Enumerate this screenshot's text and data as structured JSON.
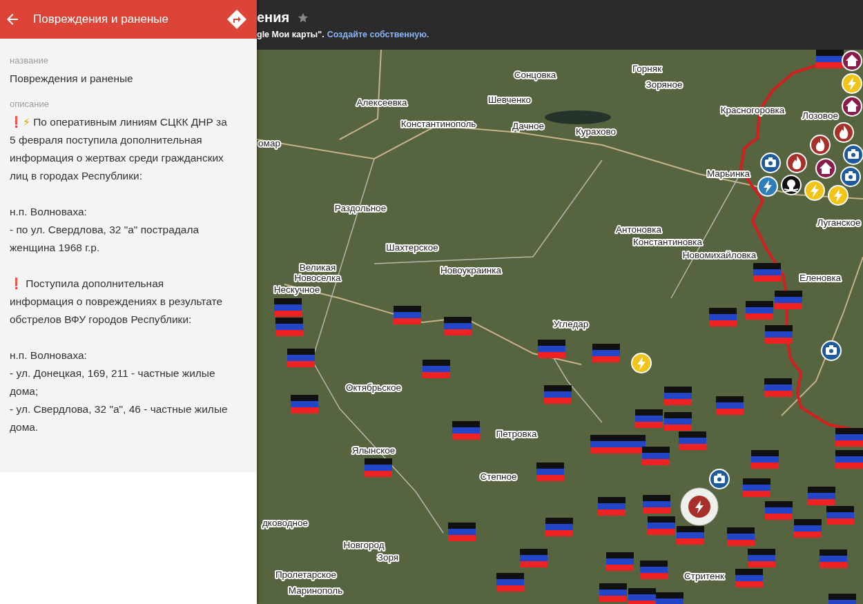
{
  "panel": {
    "title": "Повреждения и раненые",
    "fields": [
      {
        "label": "название",
        "paragraphs": [
          {
            "text": "Повреждения и раненые"
          }
        ]
      },
      {
        "label": "описание",
        "paragraphs": [
          {
            "icons": [
              {
                "kind": "exclamation",
                "char": "❗"
              },
              {
                "kind": "lightning",
                "char": "⚡"
              }
            ],
            "text": "По оперативным линиям СЦКК ДНР за 5 февраля поступила дополнительная информация о жертвах среди гражданских лиц в городах Республики:"
          },
          {
            "text": "н.п. Волноваха:\n- по ул. Свердлова, 32 \"а\" пострадала женщина 1968 г.р."
          },
          {
            "icons": [
              {
                "kind": "exclamation",
                "char": "❗"
              }
            ],
            "text": "Поступила дополнительная информация о повреждениях в результате обстрелов ВФУ городов Республики:"
          },
          {
            "text": "н.п. Волноваха:\n- ул. Донецкая, 169, 211 - частные жилые дома;\n- ул. Свердлова, 32 \"а\", 46 - частные жилые дома."
          }
        ]
      }
    ]
  },
  "map_header": {
    "title": "ения",
    "note": "gle Мои карты\".",
    "link": "Создайте собственную."
  },
  "map": {
    "labels": [
      "Сонцовка",
      "Горняк",
      "Зоряное",
      "Алексеевка",
      "Шевченко",
      "Красногоровка",
      "Лозовое",
      "Константинополь",
      "Дачное",
      "Курахово",
      "омар",
      "Марьинка",
      "Раздольное",
      "Антоновка",
      "Константиновка",
      "Луганское",
      "Шахтерское",
      "Новомихайловка",
      "Великая",
      "Новоселка",
      "Новоукраинка",
      "Нескучное",
      "Еленовка",
      "Угледар",
      "Октябрьское",
      "Петровка",
      "Ялынское",
      "Степное",
      "дководное",
      "Новгород",
      "Зоря",
      "Пролетарское",
      "Маринополь",
      "Стритенк"
    ]
  }
}
